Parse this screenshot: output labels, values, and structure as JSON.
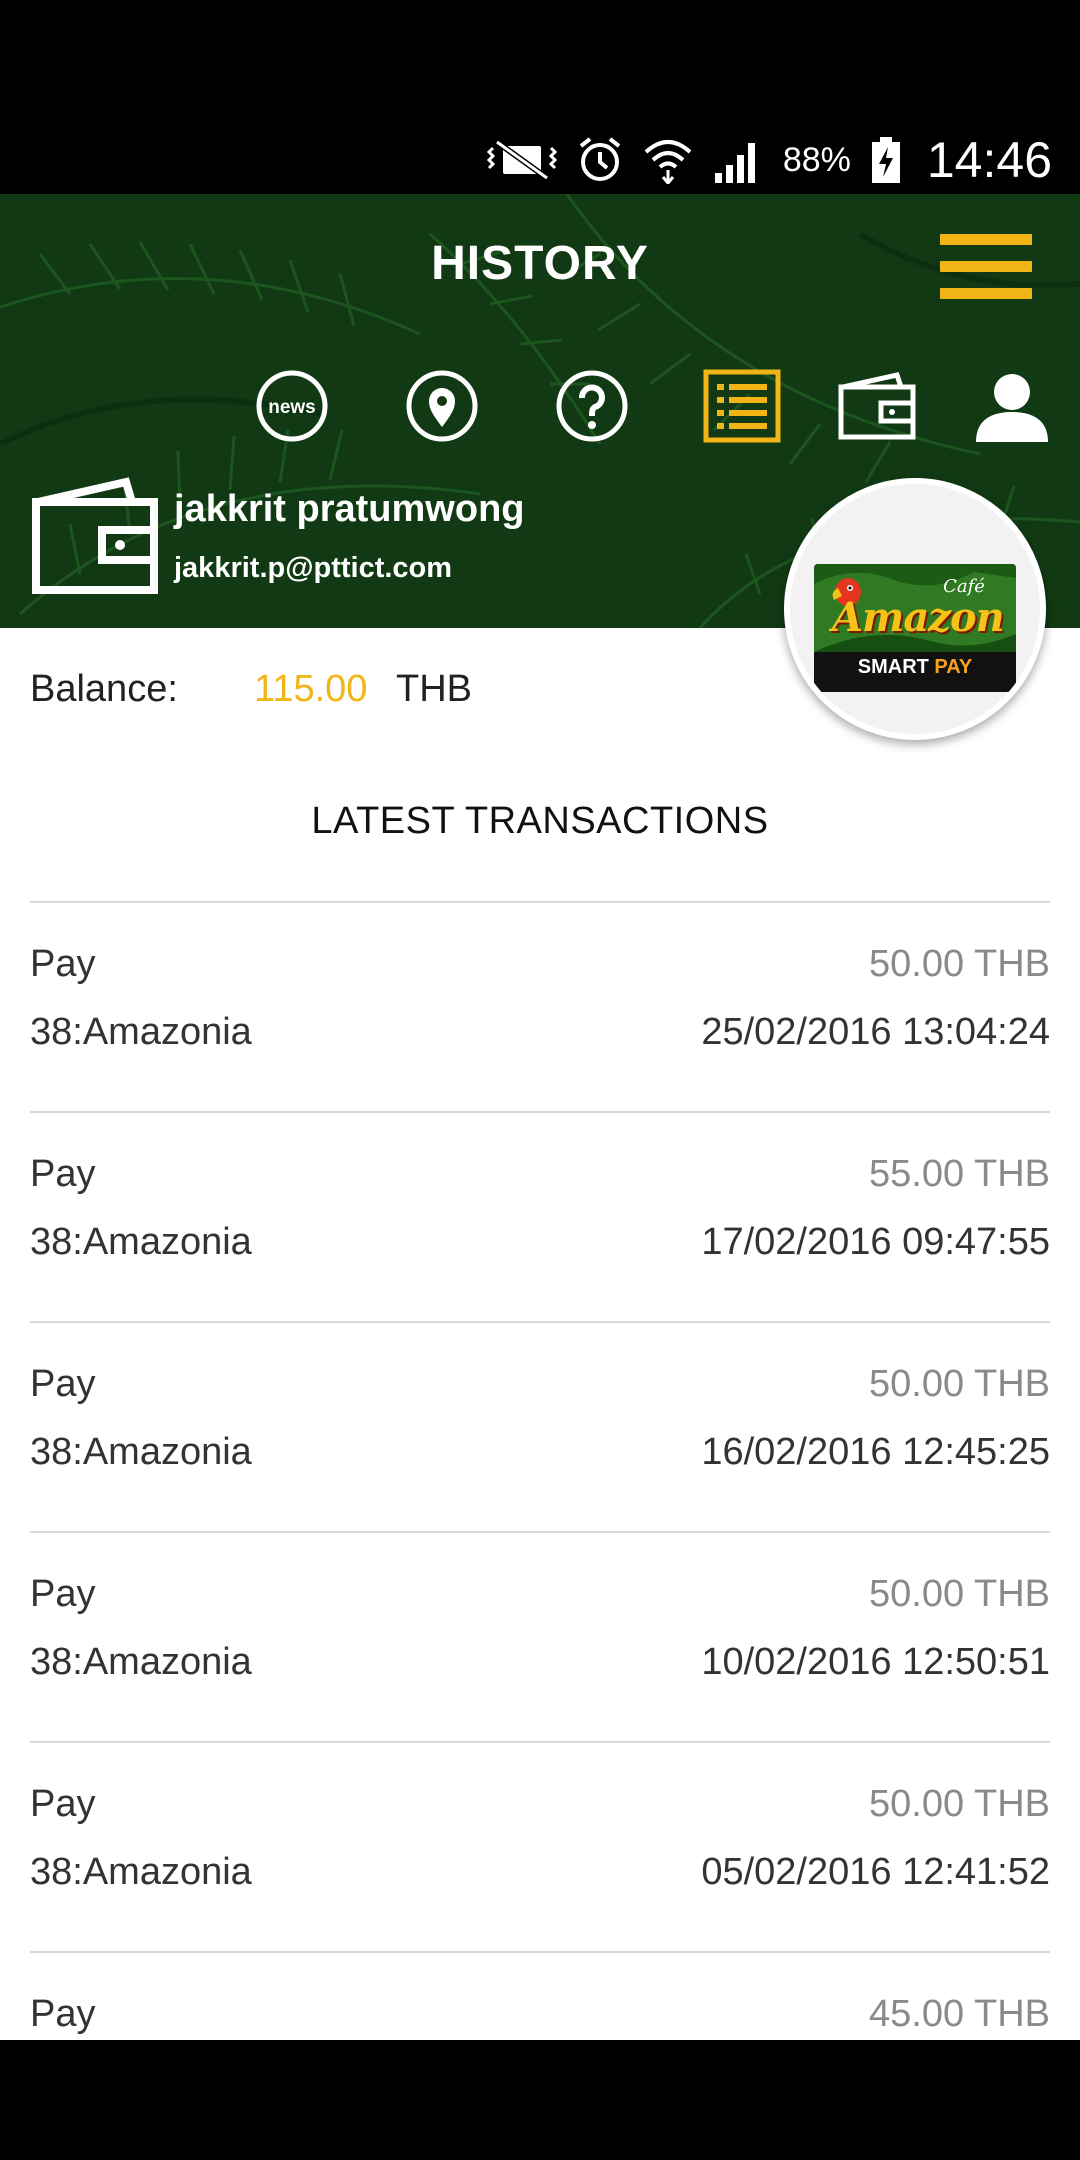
{
  "status_bar": {
    "battery": "88%",
    "time": "14:46"
  },
  "header": {
    "title": "HISTORY",
    "nav_icons": [
      "news-icon",
      "location-pin-icon",
      "help-icon",
      "history-list-icon",
      "wallet-icon",
      "profile-icon"
    ],
    "news_label": "news"
  },
  "user": {
    "name": "jakkrit pratumwong",
    "email": "jakkrit.p@pttict.com"
  },
  "balance": {
    "label": "Balance:",
    "amount": "115.00",
    "currency": "THB"
  },
  "logo": {
    "word": "Amazon",
    "cafe": "Café",
    "smart": "SMART",
    "pay": "PAY"
  },
  "transactions": {
    "title": "LATEST TRANSACTIONS",
    "items": [
      {
        "type": "Pay",
        "amount": "50.00 THB",
        "merchant": "38:Amazonia",
        "datetime": "25/02/2016 13:04:24"
      },
      {
        "type": "Pay",
        "amount": "55.00 THB",
        "merchant": "38:Amazonia",
        "datetime": "17/02/2016 09:47:55"
      },
      {
        "type": "Pay",
        "amount": "50.00 THB",
        "merchant": "38:Amazonia",
        "datetime": "16/02/2016 12:45:25"
      },
      {
        "type": "Pay",
        "amount": "50.00 THB",
        "merchant": "38:Amazonia",
        "datetime": "10/02/2016 12:50:51"
      },
      {
        "type": "Pay",
        "amount": "50.00 THB",
        "merchant": "38:Amazonia",
        "datetime": "05/02/2016 12:41:52"
      },
      {
        "type": "Pay",
        "amount": "45.00 THB",
        "merchant": "",
        "datetime": ""
      }
    ]
  },
  "colors": {
    "header_green": "#113a14",
    "accent_yellow": "#f2b518",
    "amount_gray": "#8a8a8a"
  }
}
